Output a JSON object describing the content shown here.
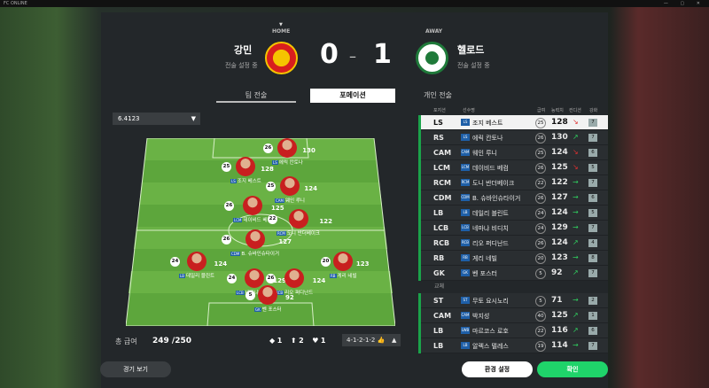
{
  "window": {
    "title": "FC ONLINE",
    "controls": "— ▢ ✕"
  },
  "match": {
    "home_tag": "HOME",
    "away_tag": "AWAY",
    "home_name": "강민",
    "home_sub": "전술 설정 중",
    "away_name": "헬로드",
    "away_sub": "전술 설정 중",
    "score_home": "0",
    "score_dash": "–",
    "score_away": "1"
  },
  "tabs": [
    "팀 전술",
    "포메이션",
    "개인 전술"
  ],
  "formation_select": {
    "value": "6.4123"
  },
  "players_on_pitch": [
    {
      "ovr": "26",
      "num": "130",
      "pos": "LS",
      "name": "에릭 칸토나"
    },
    {
      "ovr": "25",
      "num": "128",
      "pos": "LS",
      "name": "조지 베스트"
    },
    {
      "ovr": "25",
      "num": "124",
      "pos": "CAM",
      "name": "웨인 루니"
    },
    {
      "ovr": "26",
      "num": "125",
      "pos": "LCM",
      "name": "데이비드 베컴"
    },
    {
      "ovr": "22",
      "num": "122",
      "pos": "RCM",
      "name": "도니 반더베이크"
    },
    {
      "ovr": "26",
      "num": "127",
      "pos": "CDM",
      "name": "B. 슈바인슈타이거"
    },
    {
      "ovr": "24",
      "num": "124",
      "pos": "LB",
      "name": "데일리 블린트"
    },
    {
      "ovr": "24",
      "num": "129",
      "pos": "LCB",
      "name": "네마냐 비디치"
    },
    {
      "ovr": "26",
      "num": "124",
      "pos": "RCB",
      "name": "리오 퍼디난드"
    },
    {
      "ovr": "20",
      "num": "123",
      "pos": "RB",
      "name": "게리 네빌"
    },
    {
      "ovr": "5",
      "num": "92",
      "pos": "GK",
      "name": "벤 포스터"
    }
  ],
  "footer": {
    "salary_label": "총 급여",
    "salary_value": "249 /250",
    "icon1_count": "1",
    "icon2_count": "2",
    "icon3_count": "1",
    "formation": "4-1-2-1-2"
  },
  "list_headers": [
    "포지션",
    "선수명",
    "급여",
    "능력치",
    "컨디션",
    "강화"
  ],
  "starters": [
    {
      "pos": "LS",
      "pc": "LS",
      "name": "조지 베스트",
      "ov": "25",
      "st": "128",
      "arrow": "down",
      "cond": "7"
    },
    {
      "pos": "RS",
      "pc": "LS",
      "name": "에릭 칸토나",
      "ov": "26",
      "st": "130",
      "arrow": "up",
      "cond": "7"
    },
    {
      "pos": "CAM",
      "pc": "CAM",
      "name": "웨인 루니",
      "ov": "25",
      "st": "124",
      "arrow": "down",
      "cond": "6"
    },
    {
      "pos": "LCM",
      "pc": "LCM",
      "name": "데이비드 베컴",
      "ov": "26",
      "st": "125",
      "arrow": "down",
      "cond": "5"
    },
    {
      "pos": "RCM",
      "pc": "RCM",
      "name": "도니 반더베이크",
      "ov": "22",
      "st": "122",
      "arrow": "right",
      "cond": "7"
    },
    {
      "pos": "CDM",
      "pc": "CDM",
      "name": "B. 슈바인슈타이거",
      "ov": "26",
      "st": "127",
      "arrow": "right",
      "cond": "6"
    },
    {
      "pos": "LB",
      "pc": "LB",
      "name": "데일리 블린트",
      "ov": "24",
      "st": "124",
      "arrow": "right",
      "cond": "5"
    },
    {
      "pos": "LCB",
      "pc": "LCB",
      "name": "네마냐 비디치",
      "ov": "24",
      "st": "129",
      "arrow": "right",
      "cond": "7"
    },
    {
      "pos": "RCB",
      "pc": "RCB",
      "name": "리오 퍼디난드",
      "ov": "26",
      "st": "124",
      "arrow": "up",
      "cond": "4"
    },
    {
      "pos": "RB",
      "pc": "RB",
      "name": "게리 네빌",
      "ov": "20",
      "st": "123",
      "arrow": "right",
      "cond": "8"
    },
    {
      "pos": "GK",
      "pc": "GK",
      "name": "벤 포스터",
      "ov": "5",
      "st": "92",
      "arrow": "up",
      "cond": "7"
    }
  ],
  "subs_label": "교체",
  "subs": [
    {
      "pos": "ST",
      "pc": "ST",
      "name": "무토 요시노리",
      "ov": "5",
      "st": "71",
      "arrow": "right",
      "cond": "2"
    },
    {
      "pos": "CAM",
      "pc": "CAM",
      "name": "박지성",
      "ov": "40",
      "st": "125",
      "arrow": "up",
      "cond": "1"
    },
    {
      "pos": "LB",
      "pc": "LWB",
      "name": "마르코스 로호",
      "ov": "22",
      "st": "116",
      "arrow": "up",
      "cond": "6"
    },
    {
      "pos": "LB",
      "pc": "LB",
      "name": "알렉스 텔레스",
      "ov": "19",
      "st": "114",
      "arrow": "right",
      "cond": "7"
    }
  ],
  "buttons": {
    "watch": "경기 보기",
    "settings": "환경 설정",
    "ok": "확인"
  },
  "colors": {
    "accent_green": "#1fd36a",
    "selected_row": "#f2f2f2"
  }
}
